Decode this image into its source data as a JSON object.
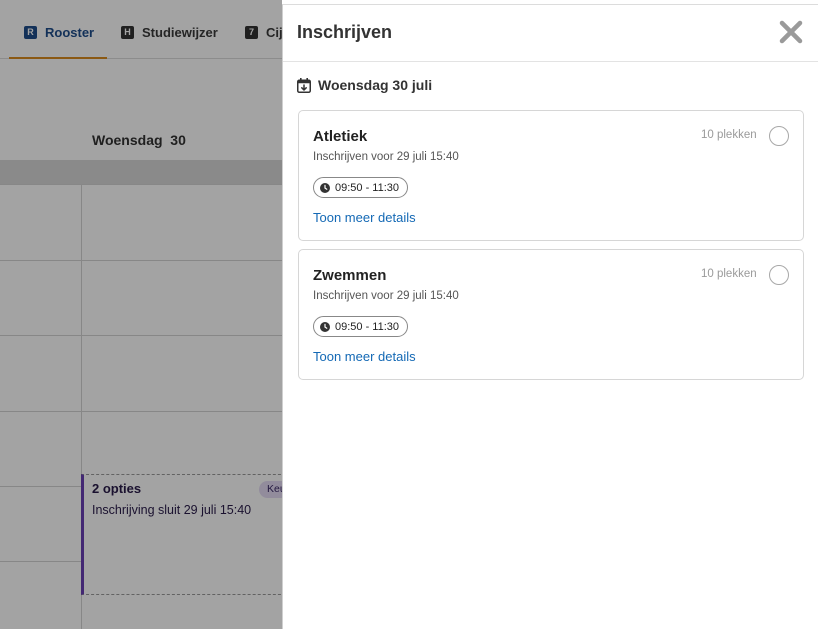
{
  "nav": {
    "tabs": [
      {
        "label": "Rooster",
        "icon_letter": "R"
      },
      {
        "label": "Studiewijzer",
        "icon_letter": "H"
      },
      {
        "label": "Cij",
        "icon_letter": "7"
      }
    ],
    "accent": "#d98c1f",
    "active_color": "#1f4e8c"
  },
  "calendar": {
    "day_label": "Woensdag  30",
    "event": {
      "title": "2 opties",
      "subtitle": "Inschrijving sluit 29 juli 15:40",
      "badge": "Keu",
      "border_color": "#6a3fb5"
    }
  },
  "panel": {
    "title": "Inschrijven",
    "date": "Woensdag 30 juli",
    "close_icon": "close-icon",
    "cards": [
      {
        "title": "Atletiek",
        "places": "10 plekken",
        "deadline": "Inschrijven voor 29 juli 15:40",
        "time": "09:50 - 11:30",
        "link": "Toon meer details"
      },
      {
        "title": "Zwemmen",
        "places": "10 plekken",
        "deadline": "Inschrijven voor 29 juli 15:40",
        "time": "09:50 - 11:30",
        "link": "Toon meer details"
      }
    ],
    "link_color": "#1469b5"
  }
}
